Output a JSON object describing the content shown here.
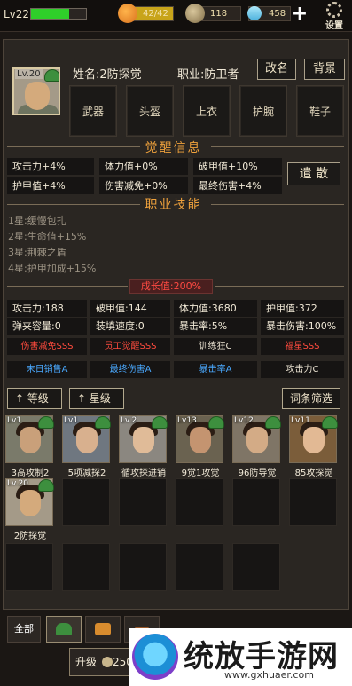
{
  "topbar": {
    "level": "Lv22",
    "hp_fill": 0.7,
    "energy": "42/42",
    "energy_fill": 1.0,
    "coins": "118",
    "gems": "458",
    "settings_label": "设置"
  },
  "hero": {
    "avatar_level": "Lv.20",
    "name": "姓名:2防探觉",
    "profession": "职业:防卫者",
    "rename_label": "改名",
    "background_label": "背景",
    "equipment": [
      "武器",
      "头盔",
      "上衣",
      "护腕",
      "鞋子"
    ]
  },
  "awaken": {
    "title": "觉醒信息",
    "stats": [
      "攻击力+4%",
      "体力值+0%",
      "破甲值+10%",
      "护甲值+4%",
      "伤害减免+0%",
      "最终伤害+4%"
    ],
    "dismiss_label": "遣 散"
  },
  "skills": {
    "title": "职业技能",
    "lines": [
      "1星:缓慢包扎",
      "2星:生命值+15%",
      "3星:荆棘之盾",
      "4星:护甲加成+15%"
    ]
  },
  "growth": {
    "label": "成长值:200%",
    "attrs": [
      "攻击力:188",
      "破甲值:144",
      "体力值:3680",
      "护甲值:372",
      "弹夹容量:0",
      "装填速度:0",
      "暴击率:5%",
      "暴击伤害:100%"
    ],
    "tags_row1": [
      {
        "text": "伤害减免SSS",
        "color": "#ff4b3e"
      },
      {
        "text": "员工觉醒SSS",
        "color": "#ff4b3e"
      },
      {
        "text": "训练狂C",
        "color": "#e8e0cf"
      },
      {
        "text": "福星SSS",
        "color": "#ff4b3e"
      }
    ],
    "tags_row2": [
      {
        "text": "末日销售A",
        "color": "#4aa9ff"
      },
      {
        "text": "最终伤害A",
        "color": "#4aa9ff"
      },
      {
        "text": "暴击率A",
        "color": "#4aa9ff"
      },
      {
        "text": "攻击力C",
        "color": "#e8e0cf"
      }
    ]
  },
  "sort": {
    "level_label": "等级",
    "star_label": "星级",
    "filter_label": "词条筛选"
  },
  "roster": [
    {
      "level": "Lv1",
      "name": "3高攻制2",
      "skin": "#c9a07a",
      "bg": "#7a7a6a"
    },
    {
      "level": "Lv1",
      "name": "5项减探2",
      "skin": "#d8b08e",
      "bg": "#6f7780"
    },
    {
      "level": "Lv.2",
      "name": "循攻探进销",
      "skin": "#e0bb98",
      "bg": "#8b8780"
    },
    {
      "level": "Lv13",
      "name": "9觉1攻觉",
      "skin": "#c49470",
      "bg": "#6a6250"
    },
    {
      "level": "Lv12",
      "name": "96防导觉",
      "skin": "#d3ab86",
      "bg": "#7f7566"
    },
    {
      "level": "Lv11",
      "name": "85攻探觉",
      "skin": "#e2b994",
      "bg": "#7b5d3a"
    },
    {
      "level": "Lv.20",
      "name": "2防探觉",
      "skin": "#d4aa7c",
      "bg": "#a49a88"
    }
  ],
  "tabs": {
    "all_label": "全部"
  },
  "upgrade": {
    "label": "升级",
    "cost": "250"
  },
  "watermark": {
    "title": "统放手游网",
    "url": "www.gxhuaer.com"
  }
}
